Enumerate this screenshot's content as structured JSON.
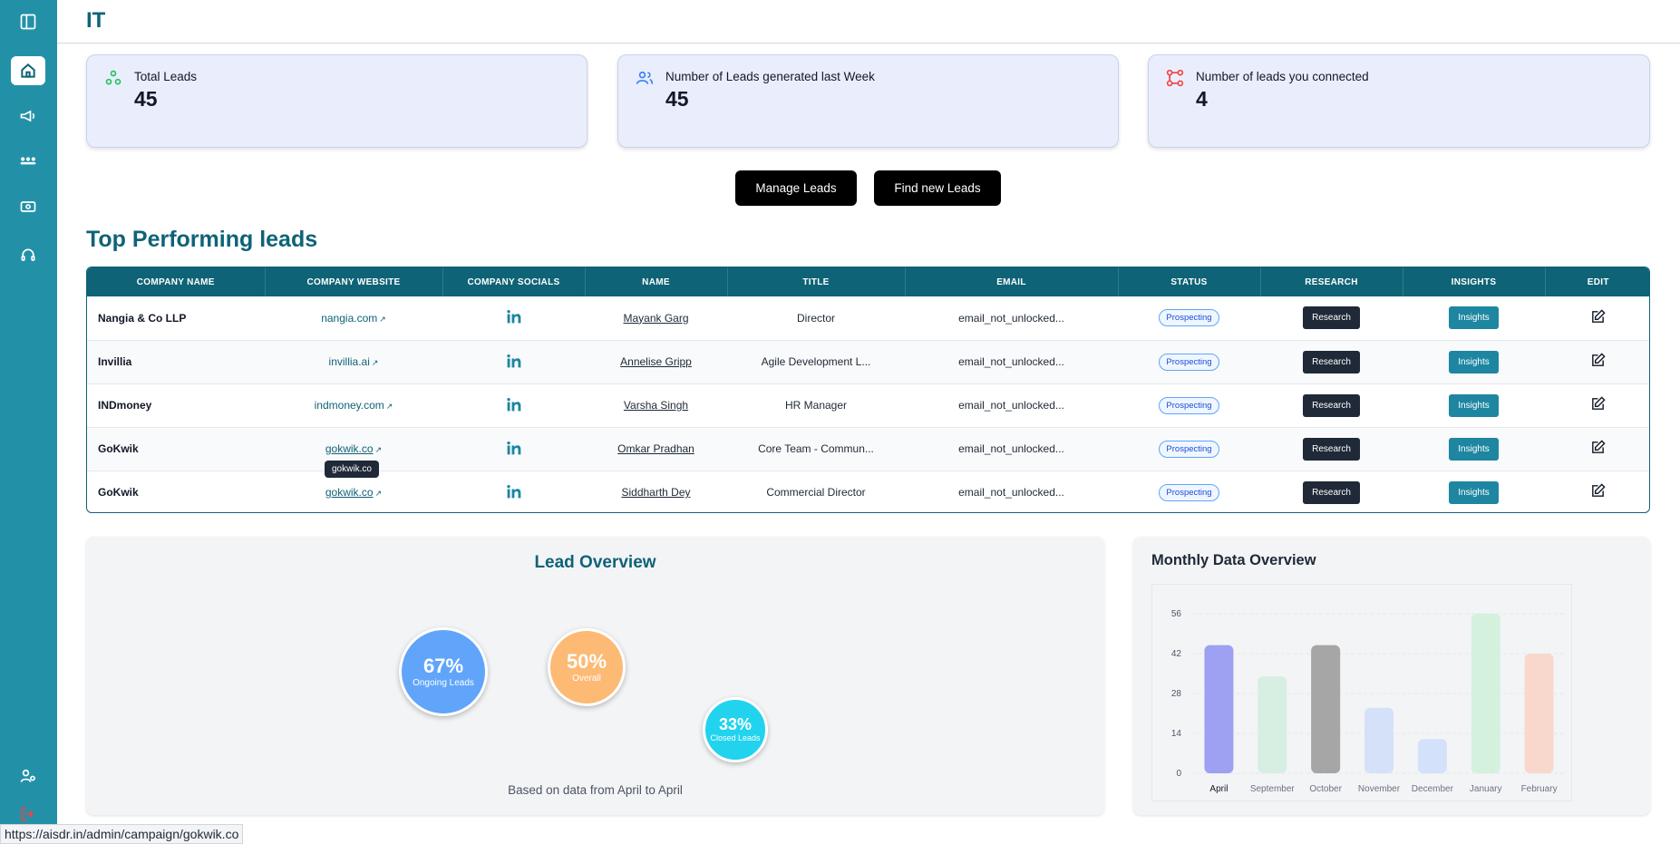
{
  "page": {
    "title": "IT"
  },
  "stats": [
    {
      "label": "Total Leads",
      "value": "45",
      "icon": "nodes-icon",
      "color": "#22c55e"
    },
    {
      "label": "Number of Leads generated last Week",
      "value": "45",
      "icon": "users-icon",
      "color": "#3b82f6"
    },
    {
      "label": "Number of leads you connected",
      "value": "4",
      "icon": "connect-icon",
      "color": "#ef4444"
    }
  ],
  "actions": {
    "manage": "Manage Leads",
    "find": "Find new Leads"
  },
  "section": {
    "title": "Top Performing leads"
  },
  "table": {
    "headers": [
      "COMPANY NAME",
      "COMPANY WEBSITE",
      "COMPANY SOCIALS",
      "NAME",
      "TITLE",
      "EMAIL",
      "STATUS",
      "RESEARCH",
      "INSIGHTS",
      "EDIT"
    ],
    "rows": [
      {
        "company": "Nangia & Co LLP",
        "website": "nangia.com",
        "name": "Mayank Garg",
        "title": "Director",
        "email": "email_not_unlocked...",
        "status": "Prospecting",
        "research": "Research",
        "insights": "Insights"
      },
      {
        "company": "Invillia",
        "website": "invillia.ai",
        "name": "Annelise Gripp",
        "title": "Agile Development L...",
        "email": "email_not_unlocked...",
        "status": "Prospecting",
        "research": "Research",
        "insights": "Insights"
      },
      {
        "company": "INDmoney",
        "website": "indmoney.com",
        "name": "Varsha Singh",
        "title": "HR Manager",
        "email": "email_not_unlocked...",
        "status": "Prospecting",
        "research": "Research",
        "insights": "Insights"
      },
      {
        "company": "GoKwik",
        "website": "gokwik.co",
        "name": "Omkar Pradhan",
        "title": "Core Team - Commun...",
        "email": "email_not_unlocked...",
        "status": "Prospecting",
        "research": "Research",
        "insights": "Insights"
      },
      {
        "company": "GoKwik",
        "website": "gokwik.co",
        "name": "Siddharth Dey",
        "title": "Commercial Director",
        "email": "email_not_unlocked...",
        "status": "Prospecting",
        "research": "Research",
        "insights": "Insights"
      }
    ]
  },
  "tooltip": "gokwik.co",
  "overview": {
    "title": "Lead Overview",
    "bubbles": [
      {
        "pct": "67%",
        "label": "Ongoing Leads",
        "color": "#60a5fa"
      },
      {
        "pct": "50%",
        "label": "Overall",
        "color": "#fdba74"
      },
      {
        "pct": "33%",
        "label": "Closed Leads",
        "color": "#22d3ee"
      }
    ],
    "note": "Based on data from April to April"
  },
  "monthly": {
    "title": "Monthly Data Overview"
  },
  "chart_data": {
    "type": "bar",
    "categories": [
      "April",
      "September",
      "October",
      "November",
      "December",
      "January",
      "February"
    ],
    "values": [
      45,
      34,
      45,
      23,
      12,
      56,
      42
    ],
    "colors": [
      "#9ea0f2",
      "#d6efe2",
      "#a6a6a6",
      "#d5e1f9",
      "#d4e1fb",
      "#d4f1de",
      "#f8d8cc"
    ],
    "yticks": [
      0,
      14,
      28,
      42,
      56
    ],
    "ylim": [
      0,
      56
    ],
    "grid": true
  },
  "statusbar": {
    "url": "https://aisdr.in/admin/campaign/gokwik.co"
  }
}
